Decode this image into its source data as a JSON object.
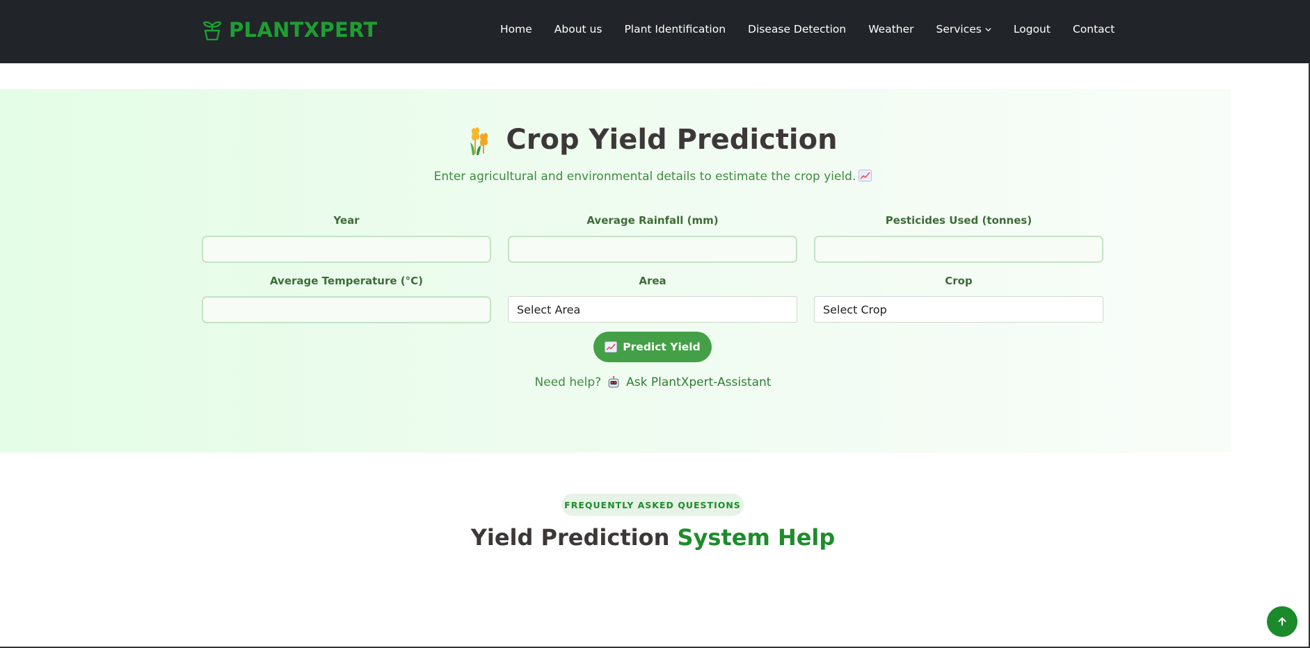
{
  "brand": {
    "name": "PLANTXPERT",
    "icon": "sprout-pot-icon"
  },
  "nav": {
    "items": [
      "Home",
      "About us",
      "Plant Identification",
      "Disease Detection",
      "Weather"
    ],
    "services_label": "Services",
    "logout_label": "Logout",
    "contact_label": "Contact"
  },
  "hero": {
    "icon": "wheat-icon",
    "title": "Crop Yield Prediction",
    "subtitle": "Enter agricultural and environmental details to estimate the crop yield."
  },
  "form": {
    "year_label": "Year",
    "year_value": "",
    "rainfall_label": "Average Rainfall (mm)",
    "rainfall_value": "",
    "pesticides_label": "Pesticides Used (tonnes)",
    "pesticides_value": "",
    "temperature_label": "Average Temperature (°C)",
    "temperature_value": "",
    "area_label": "Area",
    "area_selected": "Select Area",
    "crop_label": "Crop",
    "crop_selected": "Select Crop"
  },
  "predict_button": "Predict Yield",
  "help": {
    "prefix": "Need help?",
    "link": "Ask PlantXpert-Assistant"
  },
  "faq": {
    "badge": "FREQUENTLY ASKED QUESTIONS",
    "title_main": "Yield Prediction",
    "title_accent": "System Help"
  },
  "colors": {
    "navbar_bg": "#212529",
    "brand_green": "#1e9e32",
    "button_green": "#43a047",
    "text_green": "#3e8b40",
    "heading": "#3d3838"
  }
}
